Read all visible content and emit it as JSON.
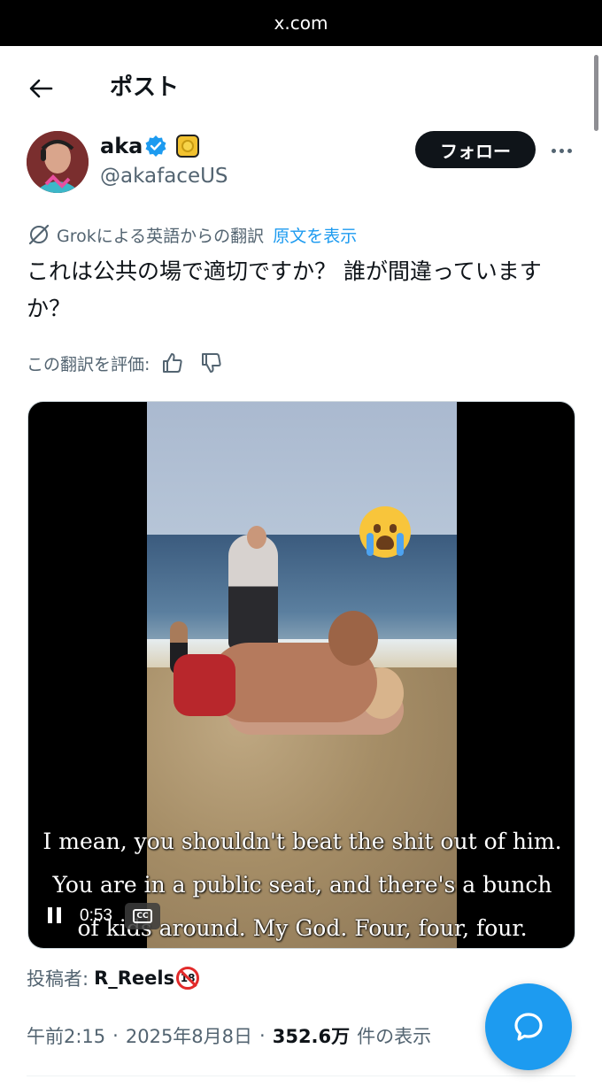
{
  "browser": {
    "url": "x.com"
  },
  "header": {
    "title": "ポスト",
    "back_icon": "arrow-left-icon"
  },
  "author": {
    "name": "aka",
    "handle": "@akafaceUS",
    "verified": true,
    "verified_color": "#1d9bf0",
    "follow_label": "フォロー"
  },
  "translation": {
    "label": "Grokによる英語からの翻訳",
    "show_original": "原文を表示"
  },
  "tweet": {
    "text": "これは公共の場で適切ですか？ 誰が間違っていますか？"
  },
  "rate_translation": {
    "label": "この翻訳を評価:"
  },
  "video": {
    "subtitles": [
      "I mean, you shouldn't beat the shit out of him.",
      "You are in a public seat, and there's a bunch",
      "of kids around. My God. Four, four, four."
    ],
    "time": "0:53",
    "cc_label": "CC"
  },
  "attribution": {
    "label": "投稿者:",
    "name": "R_Reels",
    "badge": "18"
  },
  "meta": {
    "time": "午前2:15",
    "date": "2025年8月8日",
    "separator": "·",
    "views": "352.6万",
    "views_label": "件の表示"
  },
  "colors": {
    "accent": "#1d9bf0",
    "text": "#0f1419",
    "muted": "#536471"
  }
}
